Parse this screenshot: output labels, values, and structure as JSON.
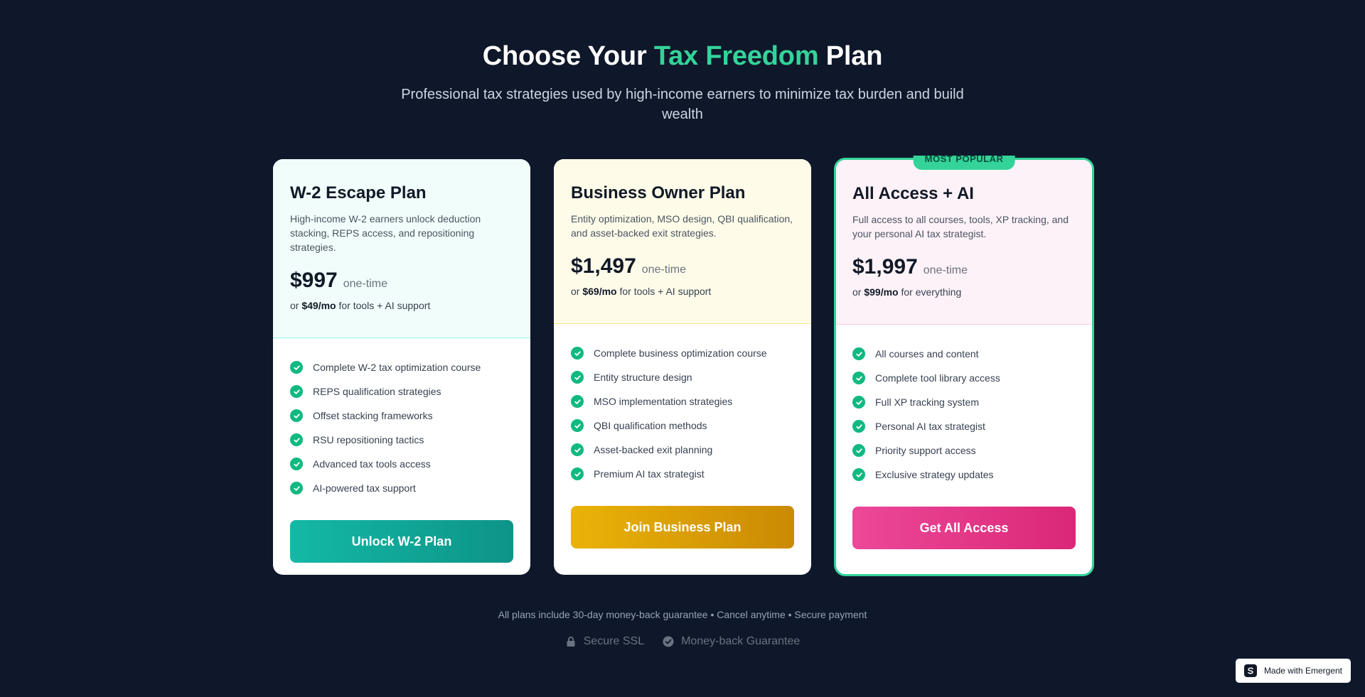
{
  "header": {
    "title_prefix": "Choose Your ",
    "title_accent": "Tax Freedom",
    "title_suffix": " Plan",
    "subtitle": "Professional tax strategies used by high-income earners to minimize tax burden and build wealth"
  },
  "plans": [
    {
      "name": "W-2 Escape Plan",
      "description": "High-income W-2 earners unlock deduction stacking, REPS access, and repositioning strategies.",
      "price": "$997",
      "price_unit": "one-time",
      "alt_prefix": "or ",
      "alt_price": "$49/mo",
      "alt_suffix": " for tools + AI support",
      "features": [
        "Complete W-2 tax optimization course",
        "REPS qualification strategies",
        "Offset stacking frameworks",
        "RSU repositioning tactics",
        "Advanced tax tools access",
        "AI-powered tax support"
      ],
      "cta": "Unlock W-2 Plan"
    },
    {
      "name": "Business Owner Plan",
      "description": "Entity optimization, MSO design, QBI qualification, and asset-backed exit strategies.",
      "price": "$1,497",
      "price_unit": "one-time",
      "alt_prefix": "or ",
      "alt_price": "$69/mo",
      "alt_suffix": " for tools + AI support",
      "features": [
        "Complete business optimization course",
        "Entity structure design",
        "MSO implementation strategies",
        "QBI qualification methods",
        "Asset-backed exit planning",
        "Premium AI tax strategist"
      ],
      "cta": "Join Business Plan"
    },
    {
      "badge": "MOST POPULAR",
      "name": "All Access + AI",
      "description": "Full access to all courses, tools, XP tracking, and your personal AI tax strategist.",
      "price": "$1,997",
      "price_unit": "one-time",
      "alt_prefix": "or ",
      "alt_price": "$99/mo",
      "alt_suffix": " for everything",
      "features": [
        "All courses and content",
        "Complete tool library access",
        "Full XP tracking system",
        "Personal AI tax strategist",
        "Priority support access",
        "Exclusive strategy updates"
      ],
      "cta": "Get All Access"
    }
  ],
  "footer": {
    "note": "All plans include 30-day money-back guarantee • Cancel anytime • Secure payment",
    "trust_ssl": "Secure SSL",
    "trust_guarantee": "Money-back Guarantee"
  },
  "made_with": "Made with Emergent",
  "colors": {
    "background": "#0f172a",
    "accent": "#34d399",
    "teal": "#14b8a6",
    "gold": "#eab308",
    "pink": "#ec4899"
  }
}
